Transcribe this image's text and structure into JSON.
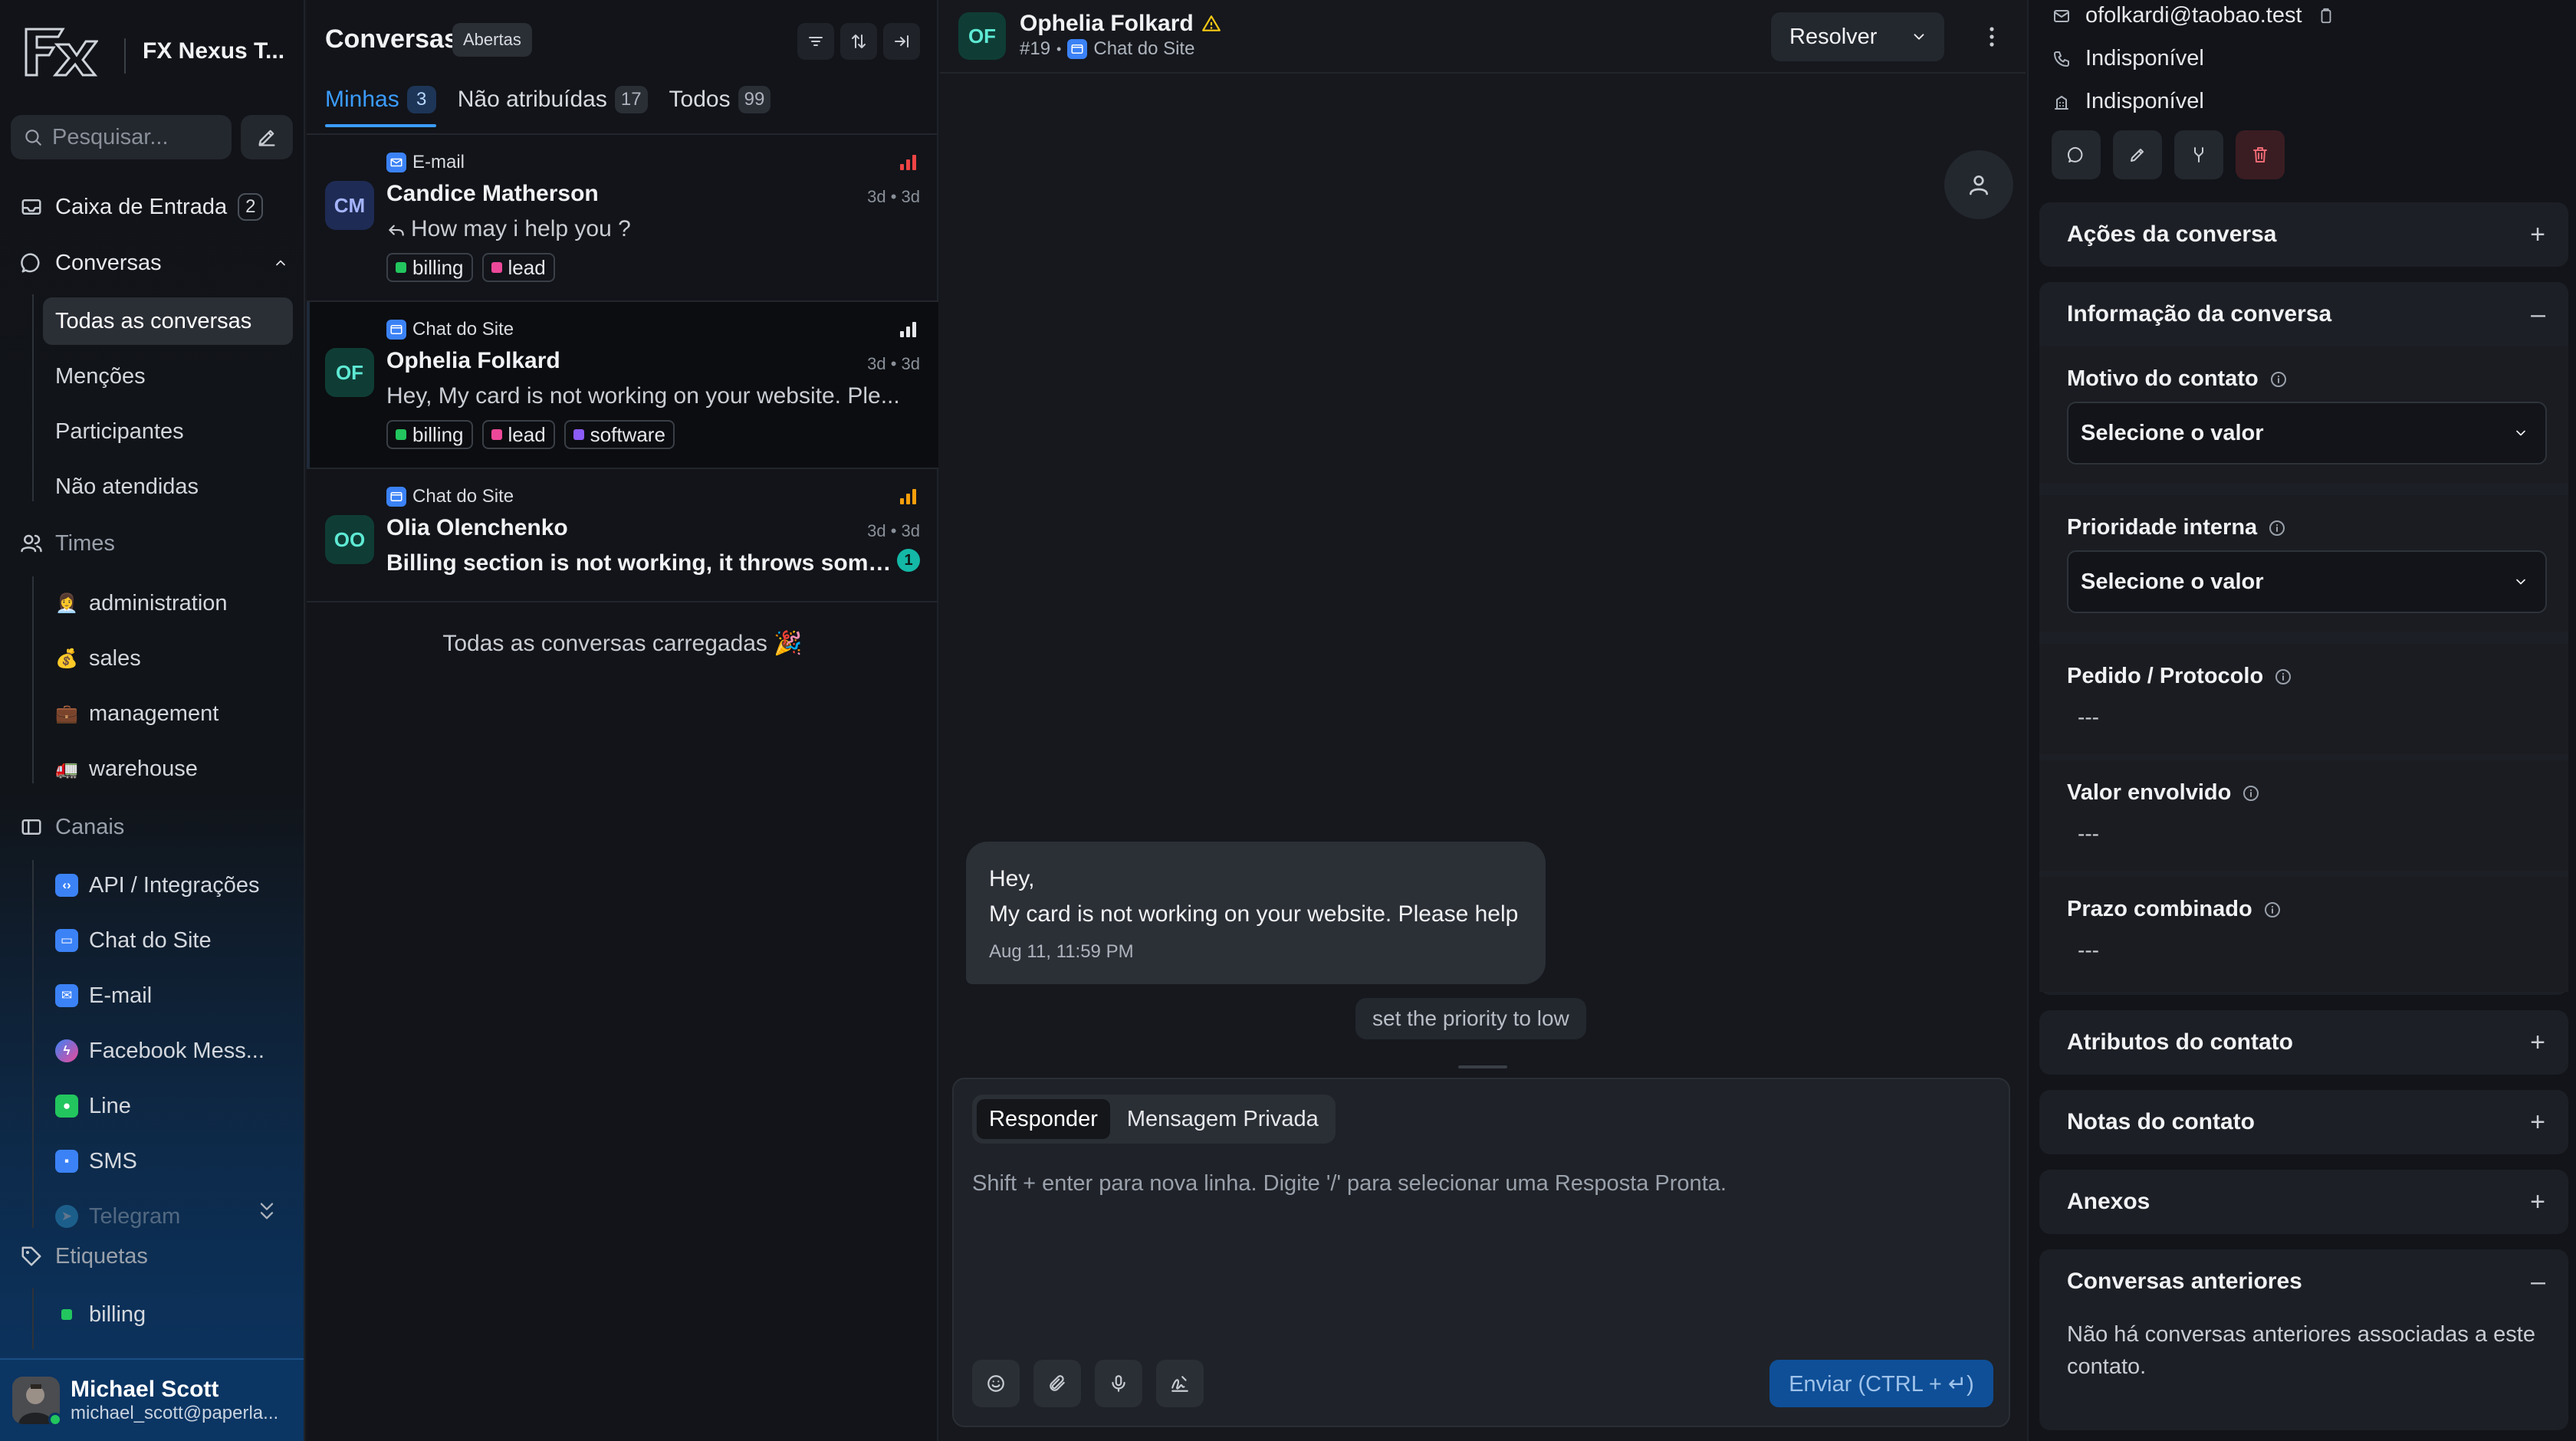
{
  "brand": {
    "name": "FX Nexus T...",
    "logo": "FX"
  },
  "search": {
    "placeholder": "Pesquisar..."
  },
  "nav": {
    "inbox": {
      "label": "Caixa de Entrada",
      "count": "2"
    },
    "conversations": {
      "label": "Conversas",
      "items": [
        {
          "label": "Todas as conversas"
        },
        {
          "label": "Menções"
        },
        {
          "label": "Participantes"
        },
        {
          "label": "Não atendidas"
        }
      ]
    },
    "teams": {
      "label": "Times",
      "items": [
        {
          "label": "administration",
          "emoji": "👩‍💼"
        },
        {
          "label": "sales",
          "emoji": "💰"
        },
        {
          "label": "management",
          "emoji": "💼"
        },
        {
          "label": "warehouse",
          "emoji": "🚛"
        }
      ]
    },
    "channels": {
      "label": "Canais",
      "items": [
        {
          "label": "API / Integrações",
          "color": "#3b82f6"
        },
        {
          "label": "Chat do Site",
          "color": "#3b82f6"
        },
        {
          "label": "E-mail",
          "color": "#3b82f6"
        },
        {
          "label": "Facebook Mess...",
          "color": "#a855f7"
        },
        {
          "label": "Line",
          "color": "#22c55e"
        },
        {
          "label": "SMS",
          "color": "#3b82f6"
        },
        {
          "label": "Telegram",
          "color": "#38bdf8"
        }
      ]
    },
    "labels": {
      "label": "Etiquetas",
      "items": [
        {
          "label": "billing",
          "color": "#22c55e"
        }
      ]
    }
  },
  "user": {
    "name": "Michael Scott",
    "email": "michael_scott@paperla..."
  },
  "convlist": {
    "title": "Conversas",
    "status": "Abertas",
    "tabs": [
      {
        "label": "Minhas",
        "count": "3"
      },
      {
        "label": "Não atribuídas",
        "count": "17"
      },
      {
        "label": "Todos",
        "count": "99"
      }
    ],
    "cards": [
      {
        "initials": "CM",
        "inbox": "E-mail",
        "name": "Candice Matherson",
        "message": "How may i help you ?",
        "time": "3d • 3d",
        "tags": [
          {
            "label": "billing",
            "color": "#22c55e"
          },
          {
            "label": "lead",
            "color": "#ec4899"
          }
        ]
      },
      {
        "initials": "OF",
        "inbox": "Chat do Site",
        "name": "Ophelia Folkard",
        "message": "Hey, My card is not working on your website. Ple...",
        "time": "3d • 3d",
        "tags": [
          {
            "label": "billing",
            "color": "#22c55e"
          },
          {
            "label": "lead",
            "color": "#ec4899"
          },
          {
            "label": "software",
            "color": "#8b5cf6"
          }
        ]
      },
      {
        "initials": "OO",
        "inbox": "Chat do Site",
        "name": "Olia Olenchenko",
        "message": "Billing section is not working, it throws some e...",
        "time": "3d • 3d",
        "unread": "1"
      }
    ],
    "loaded": "Todas as conversas carregadas 🎉"
  },
  "chat": {
    "initials": "OF",
    "name": "Ophelia Folkard",
    "id": "#19",
    "inbox": "Chat do Site",
    "resolve": "Resolver",
    "message": {
      "text": "Hey,\nMy card is not working on your website. Please help",
      "time": "Aug 11, 11:59 PM"
    },
    "activity": "set the priority to low",
    "composer": {
      "reply": "Responder",
      "private": "Mensagem Privada",
      "placeholder": "Shift + enter para nova linha. Digite '/' para selecionar uma Resposta Pronta.",
      "send": "Enviar (CTRL + ↵)"
    }
  },
  "contact": {
    "email": "ofolkardi@taobao.test",
    "phone": "Indisponível",
    "company": "Indisponível"
  },
  "panel": {
    "actions": "Ações da conversa",
    "info": "Informação da conversa",
    "attributes": [
      {
        "label": "Motivo do contato",
        "select": "Selecione o valor"
      },
      {
        "label": "Prioridade interna",
        "select": "Selecione o valor"
      },
      {
        "label": "Pedido / Protocolo",
        "value": "---"
      },
      {
        "label": "Valor envolvido",
        "value": "---"
      },
      {
        "label": "Prazo combinado",
        "value": "---"
      }
    ],
    "contact_attributes": "Atributos do contato",
    "contact_notes": "Notas do contato",
    "attachments": "Anexos",
    "previous": "Conversas anteriores",
    "previous_empty": "Não há conversas anteriores associadas a este contato."
  },
  "colors": {
    "accent": "#3b9cff",
    "sidebar_bottom": "#0b3563",
    "send": "#0f4f97",
    "danger": "#f16a75"
  }
}
